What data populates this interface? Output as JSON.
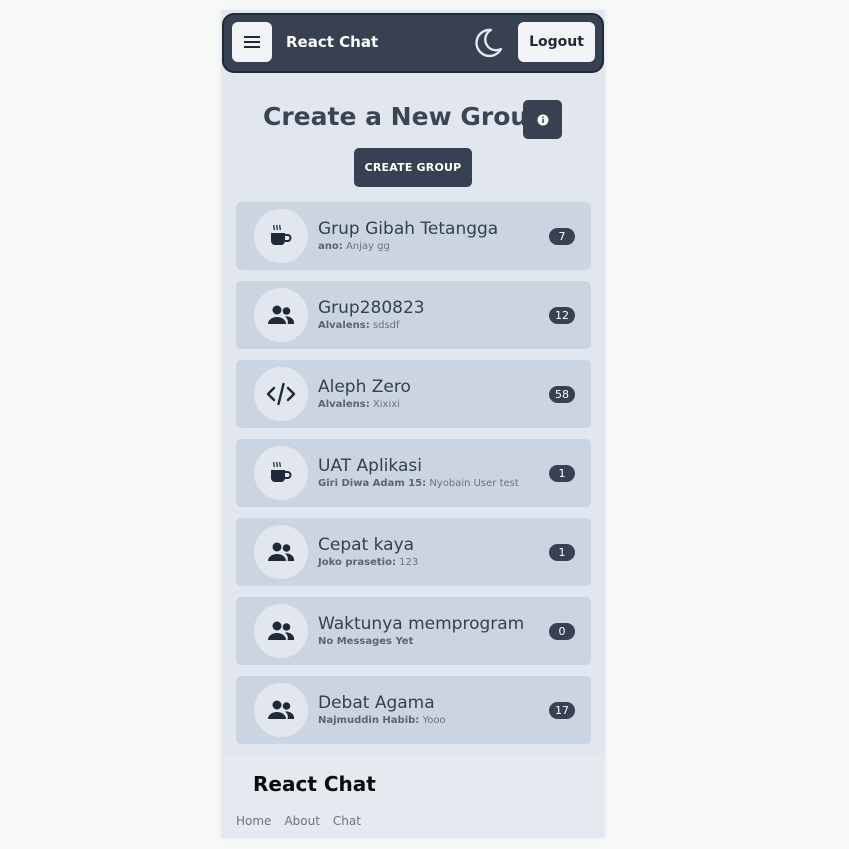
{
  "navbar": {
    "brand": "React Chat",
    "logout_label": "Logout"
  },
  "header": {
    "title": "Create a New Group",
    "create_label": "CREATE GROUP"
  },
  "groups": [
    {
      "name": "Grup Gibah Tetangga",
      "sender": "ano:",
      "message": "Anjay gg",
      "count": "7",
      "icon": "mug-hot-icon"
    },
    {
      "name": "Grup280823",
      "sender": "Alvalens:",
      "message": "sdsdf",
      "count": "12",
      "icon": "users-icon"
    },
    {
      "name": "Aleph Zero",
      "sender": "Alvalens:",
      "message": "Xixixi",
      "count": "58",
      "icon": "code-icon"
    },
    {
      "name": "UAT Aplikasi",
      "sender": "Giri Diwa Adam 15:",
      "message": "Nyobain User test",
      "count": "1",
      "icon": "mug-hot-icon"
    },
    {
      "name": "Cepat kaya",
      "sender": "Joko prasetio:",
      "message": "123",
      "count": "1",
      "icon": "users-icon"
    },
    {
      "name": "Waktunya memprogram",
      "sender": "No Messages Yet",
      "message": "",
      "count": "0",
      "icon": "users-icon"
    },
    {
      "name": "Debat Agama",
      "sender": "Najmuddin Habib:",
      "message": "Yooo",
      "count": "17",
      "icon": "users-icon"
    }
  ],
  "footer": {
    "brand": "React Chat",
    "links": [
      "Home",
      "About",
      "Chat"
    ]
  },
  "colors": {
    "navbar_bg": "#384152",
    "item_bg": "#cbd5e1",
    "page_bg": "#e2e7ef"
  }
}
